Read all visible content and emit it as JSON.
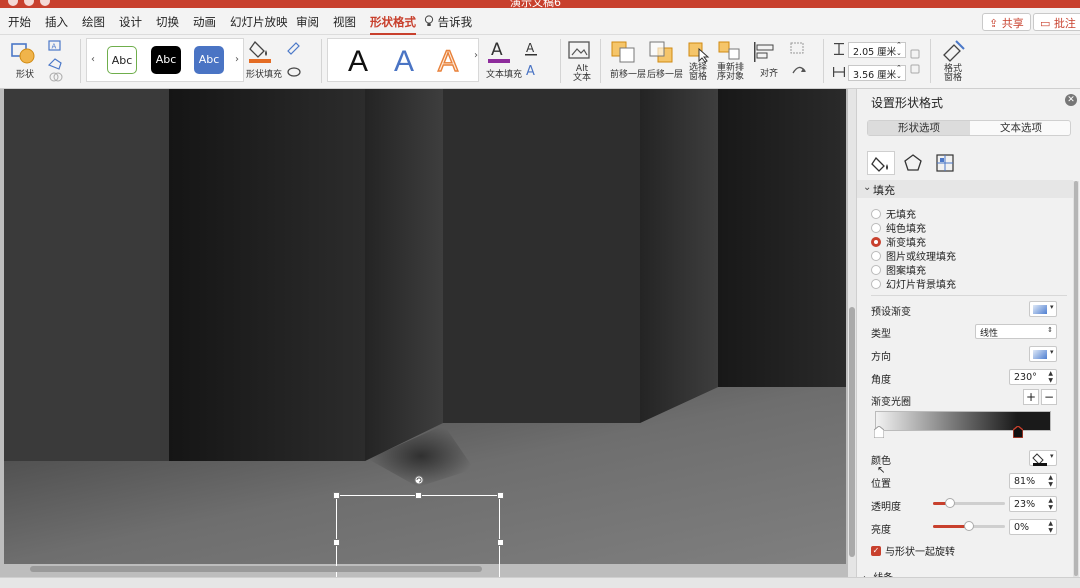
{
  "window": {
    "title": "演示文稿6"
  },
  "tabs": [
    {
      "label": "开始"
    },
    {
      "label": "插入"
    },
    {
      "label": "绘图"
    },
    {
      "label": "设计"
    },
    {
      "label": "切换"
    },
    {
      "label": "动画"
    },
    {
      "label": "幻灯片放映"
    },
    {
      "label": "审阅"
    },
    {
      "label": "视图"
    },
    {
      "label": "形状格式"
    },
    {
      "label": "告诉我"
    }
  ],
  "header_buttons": {
    "share": "共享",
    "comment": "批注"
  },
  "ribbon": {
    "shape_label": "形状",
    "style_samples": [
      "Abc",
      "Abc",
      "Abc"
    ],
    "shape_fill": "形状填充",
    "wordart_samples": [
      "A",
      "A",
      "A"
    ],
    "text_fill": "文本填充",
    "alt_text_line1": "Alt",
    "alt_text_line2": "文本",
    "bring_forward": "前移一层",
    "send_backward": "后移一层",
    "selection_pane_line1": "选择",
    "selection_pane_line2": "窗格",
    "reorder_line1": "重新排",
    "reorder_line2": "序对象",
    "align": "对齐",
    "height_value": "2.05 厘米",
    "width_value": "3.56 厘米",
    "format_pane_line1": "格式",
    "format_pane_line2": "窗格"
  },
  "panel": {
    "title": "设置形状格式",
    "tab_shape": "形状选项",
    "tab_text": "文本选项",
    "fill_section": "填充",
    "fill_options": [
      {
        "label": "无填充",
        "selected": false
      },
      {
        "label": "纯色填充",
        "selected": false
      },
      {
        "label": "渐变填充",
        "selected": true
      },
      {
        "label": "图片或纹理填充",
        "selected": false
      },
      {
        "label": "图案填充",
        "selected": false
      },
      {
        "label": "幻灯片背景填充",
        "selected": false
      }
    ],
    "preset_gradient": "预设渐变",
    "type_label": "类型",
    "type_value": "线性",
    "direction_label": "方向",
    "angle_label": "角度",
    "angle_value": "230°",
    "gradient_stops": "渐变光圈",
    "color_label": "颜色",
    "position_label": "位置",
    "position_value": "81%",
    "transparency_label": "透明度",
    "transparency_value": "23%",
    "transparency_level": 0.23,
    "brightness_label": "亮度",
    "brightness_value": "0%",
    "brightness_level": 0.5,
    "rotate_with_shape": "与形状一起旋转",
    "line_section": "线条"
  },
  "colors": {
    "accent": "#c8402d",
    "ribbon_bg": "#f3f3f3",
    "panel_bg": "#f1f1f1"
  }
}
